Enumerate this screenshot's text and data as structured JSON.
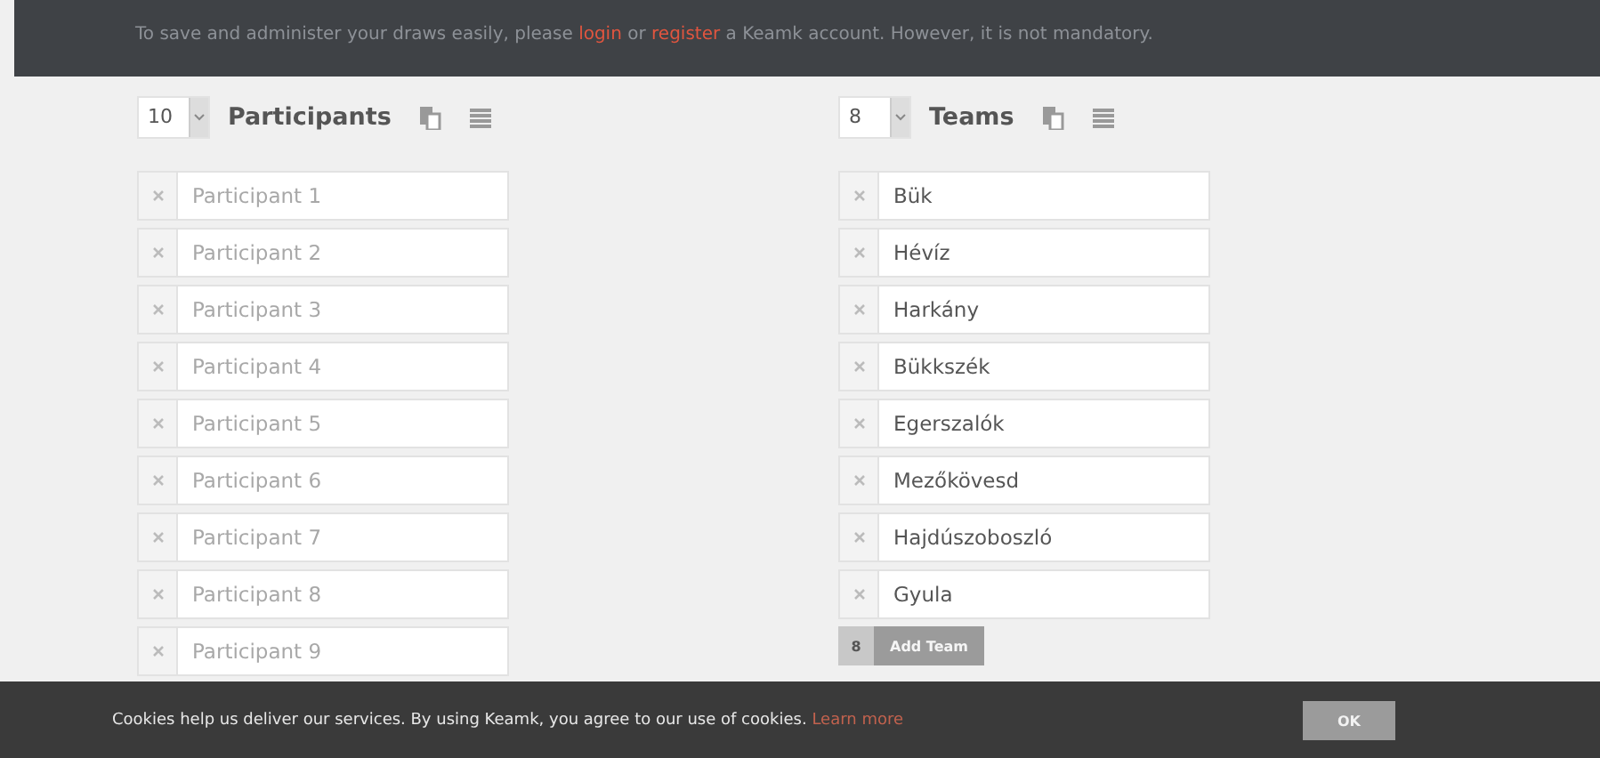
{
  "notice": {
    "before": "To save and administer your draws easily, please ",
    "login": "login",
    "middle": " or ",
    "register": "register",
    "after": " a Keamk account. However, it is not mandatory."
  },
  "participants": {
    "count": "10",
    "title": "Participants",
    "entries": [
      {
        "placeholder": "Participant 1"
      },
      {
        "placeholder": "Participant 2"
      },
      {
        "placeholder": "Participant 3"
      },
      {
        "placeholder": "Participant 4"
      },
      {
        "placeholder": "Participant 5"
      },
      {
        "placeholder": "Participant 6"
      },
      {
        "placeholder": "Participant 7"
      },
      {
        "placeholder": "Participant 8"
      },
      {
        "placeholder": "Participant 9"
      }
    ]
  },
  "teams": {
    "count": "8",
    "title": "Teams",
    "entries": [
      {
        "value": "Bük"
      },
      {
        "value": "Hévíz"
      },
      {
        "value": "Harkány"
      },
      {
        "value": "Bükkszék"
      },
      {
        "value": "Egerszalók"
      },
      {
        "value": "Mezőkövesd"
      },
      {
        "value": "Hajdúszoboszló"
      },
      {
        "value": "Gyula"
      }
    ],
    "add_button": {
      "count": "8",
      "label": "Add Team"
    }
  },
  "cookie_bar": {
    "text": "Cookies help us deliver our services. By using Keamk, you agree to our use of cookies.",
    "link": "Learn more",
    "button": "OK"
  }
}
